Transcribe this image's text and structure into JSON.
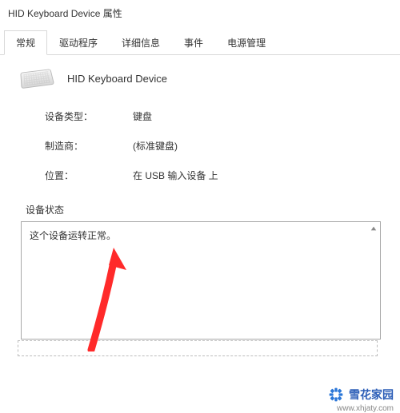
{
  "window": {
    "title": "HID Keyboard Device 属性"
  },
  "tabs": [
    {
      "label": "常规",
      "active": true
    },
    {
      "label": "驱动程序",
      "active": false
    },
    {
      "label": "详细信息",
      "active": false
    },
    {
      "label": "事件",
      "active": false
    },
    {
      "label": "电源管理",
      "active": false
    }
  ],
  "device": {
    "name": "HID Keyboard Device"
  },
  "properties": {
    "type_label": "设备类型：",
    "type_value": "键盘",
    "manufacturer_label": "制造商：",
    "manufacturer_value": "(标准键盘)",
    "location_label": "位置：",
    "location_value": "在 USB 输入设备 上"
  },
  "status": {
    "header": "设备状态",
    "text": "这个设备运转正常。"
  },
  "watermark": {
    "brand_cn": "雪花家园",
    "url": "www.xhjaty.com"
  }
}
